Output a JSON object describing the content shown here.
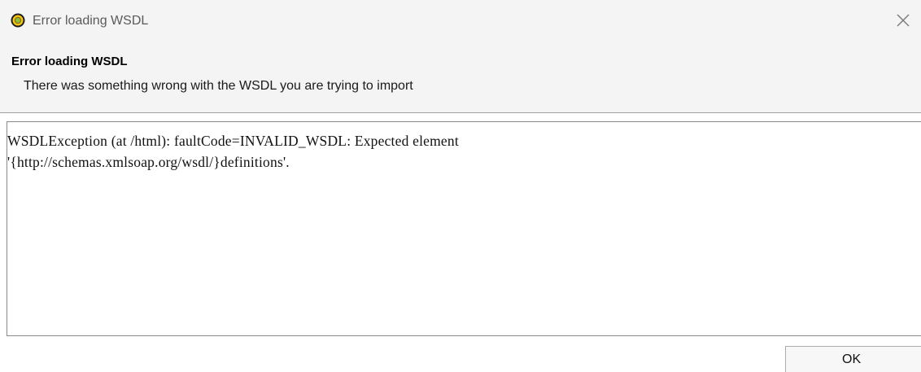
{
  "window": {
    "title": "Error loading WSDL",
    "icon": "app-icon",
    "close_icon": "close-icon"
  },
  "header": {
    "title": "Error loading WSDL",
    "message": "There was something wrong with the WSDL you are trying to import"
  },
  "error_details": {
    "lines": [
      "WSDLException (at /html): faultCode=INVALID_WSDL: Expected element",
      "'{http://schemas.xmlsoap.org/wsdl/}definitions'."
    ]
  },
  "buttons": {
    "ok_label": "OK"
  },
  "colors": {
    "icon_outer": "#1e1e1e",
    "icon_ring": "#f5c518",
    "icon_core": "#8fbf3a"
  }
}
